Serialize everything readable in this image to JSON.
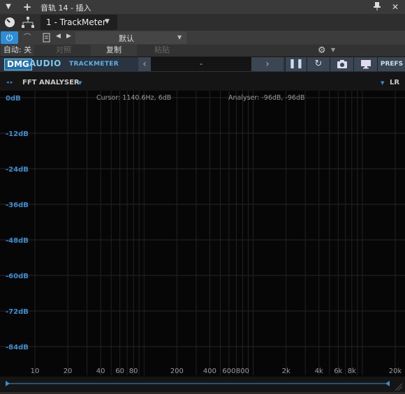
{
  "titlebar": {
    "title": "音轨 14 - 插入",
    "menu_icon": "triangle-down-icon",
    "add_icon": "plus-icon",
    "pin_icon": "pin-icon",
    "close_icon": "close-icon"
  },
  "toolbar": {
    "plugin_name": "1 - TrackMeter",
    "preset": "默认",
    "auto_label": "自动: 关",
    "compare_label": "对照",
    "copy_label": "复制",
    "paste_label": "粘贴"
  },
  "dmg": {
    "brand": "DMG",
    "audio": "AUDIO",
    "product": "TRACKMETER",
    "preset_name": "-",
    "prefs_label": "PREFS"
  },
  "analyser": {
    "title": "FFT ANALYSER",
    "channel": "LR",
    "cursor_text": "Cursor: 1140.6Hz, 6dB",
    "analyser_text": "Analyser: -96dB, -96dB",
    "db_labels": [
      "0dB",
      "-12dB",
      "-24dB",
      "-36dB",
      "-48dB",
      "-60dB",
      "-72dB",
      "-84dB"
    ],
    "freq_labels": [
      "10",
      "20",
      "40",
      "60",
      "80",
      "200",
      "400",
      "600",
      "800",
      "2k",
      "4k",
      "6k",
      "8k",
      "20k"
    ],
    "db_color": "#3a8fd0"
  }
}
